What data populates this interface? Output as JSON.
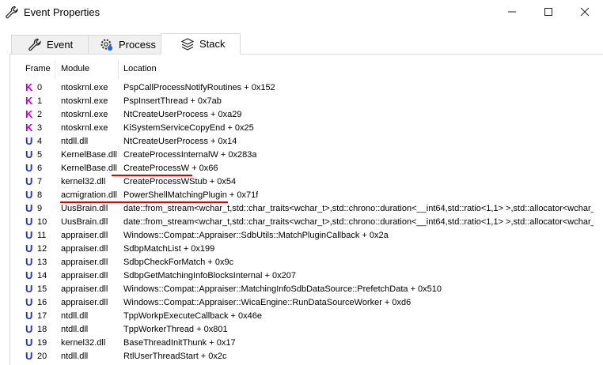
{
  "window": {
    "title": "Event Properties",
    "title_icon": "wrench-icon",
    "controls": [
      "minimize-icon",
      "maximize-icon",
      "close-icon"
    ]
  },
  "tabs": [
    {
      "label": "Event",
      "icon": "wrench-icon",
      "active": false
    },
    {
      "label": "Process",
      "icon": "gear-icon",
      "active": false
    },
    {
      "label": "Stack",
      "icon": "stack-icon",
      "active": true
    }
  ],
  "table": {
    "columns": [
      "Frame",
      "Module",
      "Location"
    ],
    "rows": [
      {
        "type": "K",
        "frame": "0",
        "module": "ntoskrnl.exe",
        "location": "PspCallProcessNotifyRoutines + 0x152"
      },
      {
        "type": "K",
        "frame": "1",
        "module": "ntoskrnl.exe",
        "location": "PspInsertThread + 0x7ab"
      },
      {
        "type": "K",
        "frame": "2",
        "module": "ntoskrnl.exe",
        "location": "NtCreateUserProcess + 0xa29"
      },
      {
        "type": "K",
        "frame": "3",
        "module": "ntoskrnl.exe",
        "location": "KiSystemServiceCopyEnd + 0x25"
      },
      {
        "type": "U",
        "frame": "4",
        "module": "ntdll.dll",
        "location": "NtCreateUserProcess + 0x14"
      },
      {
        "type": "U",
        "frame": "5",
        "module": "KernelBase.dll",
        "location": "CreateProcessInternalW + 0x283a"
      },
      {
        "type": "U",
        "frame": "6",
        "module": "KernelBase.dll",
        "location": "CreateProcessW + 0x66"
      },
      {
        "type": "U",
        "frame": "7",
        "module": "kernel32.dll",
        "location": "CreateProcessWStub + 0x54"
      },
      {
        "type": "U",
        "frame": "8",
        "module": "acmigration.dll",
        "location": "PowerShellMatchingPlugin + 0x71f"
      },
      {
        "type": "U",
        "frame": "9",
        "module": "UusBrain.dll",
        "location": "date::from_stream<wchar_t,std::char_traits<wchar_t>,std::chrono::duration<__int64,std::ratio<1,1> >,std::allocator<wchar_t"
      },
      {
        "type": "U",
        "frame": "10",
        "module": "UusBrain.dll",
        "location": "date::from_stream<wchar_t,std::char_traits<wchar_t>,std::chrono::duration<__int64,std::ratio<1,1> >,std::allocator<wchar_t"
      },
      {
        "type": "U",
        "frame": "11",
        "module": "appraiser.dll",
        "location": "Windows::Compat::Appraiser::SdbUtils::MatchPluginCallback + 0x2a"
      },
      {
        "type": "U",
        "frame": "12",
        "module": "appraiser.dll",
        "location": "SdbpMatchList + 0x199"
      },
      {
        "type": "U",
        "frame": "13",
        "module": "appraiser.dll",
        "location": "SdbpCheckForMatch + 0x9c"
      },
      {
        "type": "U",
        "frame": "14",
        "module": "appraiser.dll",
        "location": "SdbpGetMatchingInfoBlocksInternal + 0x207"
      },
      {
        "type": "U",
        "frame": "15",
        "module": "appraiser.dll",
        "location": "Windows::Compat::Appraiser::MatchingInfoSdbDataSource::PrefetchData + 0x510"
      },
      {
        "type": "U",
        "frame": "16",
        "module": "appraiser.dll",
        "location": "Windows::Compat::Appraiser::WicaEngine::RunDataSourceWorker + 0xd6"
      },
      {
        "type": "U",
        "frame": "17",
        "module": "ntdll.dll",
        "location": "TppWorkpExecuteCallback + 0x46e"
      },
      {
        "type": "U",
        "frame": "18",
        "module": "ntdll.dll",
        "location": "TppWorkerThread + 0x801"
      },
      {
        "type": "U",
        "frame": "19",
        "module": "kernel32.dll",
        "location": "BaseThreadInitThunk + 0x17"
      },
      {
        "type": "U",
        "frame": "20",
        "module": "ntdll.dll",
        "location": "RtlUserThreadStart + 0x2c"
      }
    ]
  },
  "annotations": {
    "underline_color": "#e00000",
    "underlined_frames": [
      "6",
      "8"
    ]
  },
  "colors": {
    "kernel": "#c000c0",
    "user": "#1f2fd0"
  }
}
